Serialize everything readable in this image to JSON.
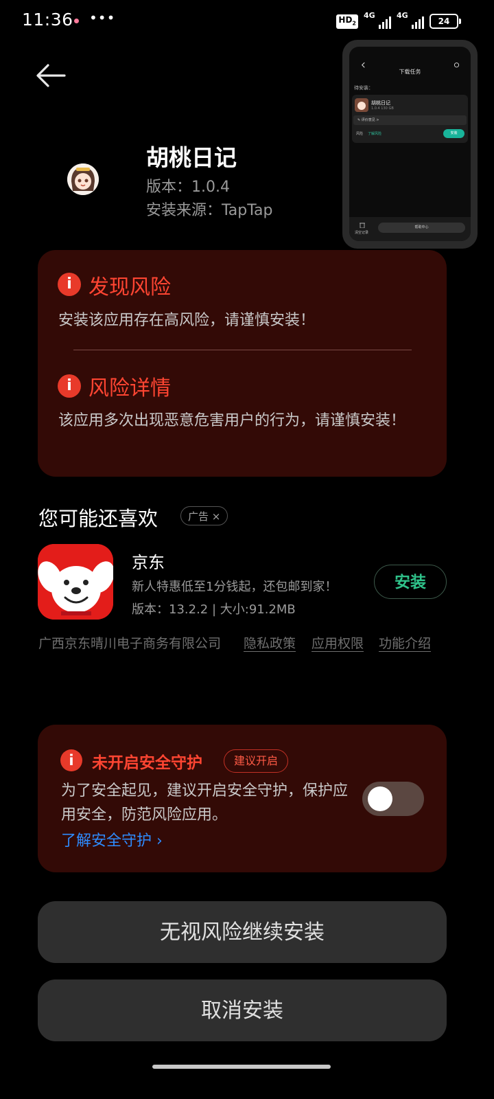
{
  "status_bar": {
    "time": "11:36",
    "more": "•••",
    "hd_label": "HD",
    "hd_sub": "2",
    "signal1_label": "4G",
    "signal2_label": "4G",
    "battery": "24"
  },
  "app": {
    "name": "胡桃日记",
    "version": "版本：1.0.4",
    "source": "安装来源：TapTap"
  },
  "preview": {
    "title": "下载任务",
    "subtitle": "待安装：",
    "app_name": "胡桃日记",
    "meta": "1.0.4  130 GB",
    "feedback": "✎ 评价意见 >",
    "risk_label": "风险",
    "risk_link": "了解风险",
    "install": "安装",
    "clear": "清空记录",
    "center": "帮助中心"
  },
  "risk": {
    "title": "发现风险",
    "desc": "安装该应用存在高风险，请谨慎安装！",
    "detail_title": "风险详情",
    "detail_desc": "该应用多次出现恶意危害用户的行为，请谨慎安装！"
  },
  "recommend": {
    "title": "您可能还喜欢",
    "ad_label": "广告 ×",
    "app_name": "京东",
    "desc": "新人特惠低至1分钱起，还包邮到家！",
    "meta": "版本：13.2.2  |  大小:91.2MB",
    "install": "安装",
    "developer": "广西京东晴川电子商务有限公司",
    "privacy": "隐私政策",
    "permissions": "应用权限",
    "features": "功能介绍"
  },
  "security": {
    "title": "未开启安全守护",
    "tag": "建议开启",
    "desc": "为了安全起见，建议开启安全守护，保护应用安全，防范风险应用。",
    "link": "了解安全守护 ›",
    "toggle_on": false
  },
  "buttons": {
    "ignore": "无视风险继续安装",
    "cancel": "取消安装"
  },
  "colors": {
    "background": "#000000",
    "panel": "#330a06",
    "risk_red": "#ff4532",
    "install_green": "#2fc28a",
    "link_blue": "#2e8cff",
    "button_gray": "#2f2f2f"
  }
}
